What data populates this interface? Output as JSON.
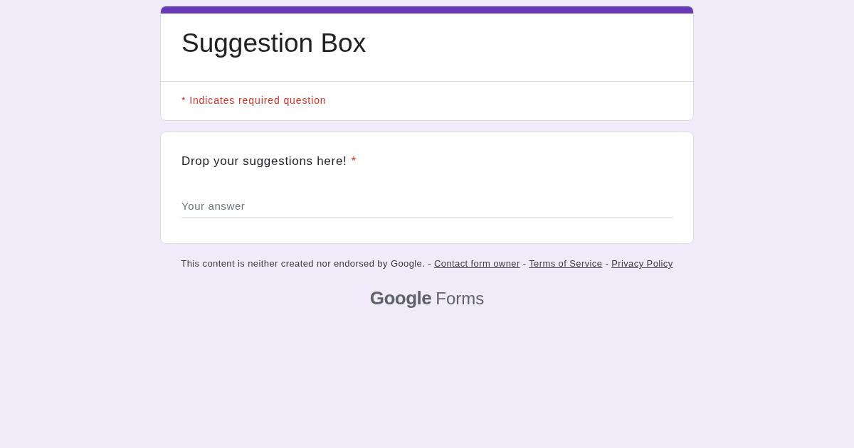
{
  "form": {
    "title": "Suggestion Box",
    "required_notice": "* Indicates required question"
  },
  "questions": [
    {
      "title": "Drop your suggestions here!",
      "required": true,
      "required_mark": "*",
      "placeholder": "Your answer"
    }
  ],
  "footer": {
    "parts": [
      {
        "kind": "text",
        "text": "This content is neither created nor endorsed by Google. -"
      },
      {
        "kind": "link",
        "text": "Contact form owner"
      },
      {
        "kind": "text",
        "text": "-"
      },
      {
        "kind": "link",
        "text": "Terms of Service"
      },
      {
        "kind": "text",
        "text": "-"
      },
      {
        "kind": "link",
        "text": "Privacy Policy"
      }
    ]
  },
  "logo": {
    "brand": "Google",
    "product": "Forms"
  }
}
